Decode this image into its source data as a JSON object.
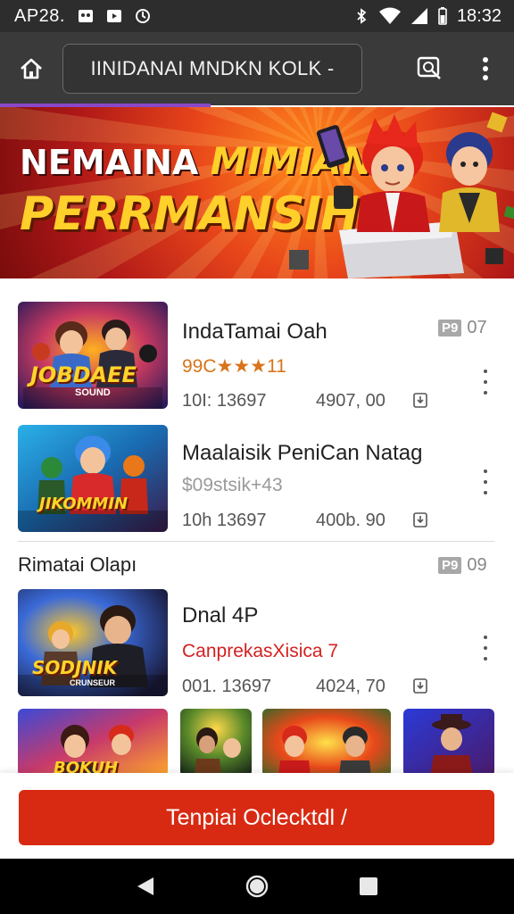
{
  "status_bar": {
    "left_text": "AP28.",
    "clock": "18:32"
  },
  "browser": {
    "url": "IINIDANAI MNDKN KOLK -"
  },
  "banner": {
    "line1_white": "NEMAINA",
    "line1_gold": "MIMIAN",
    "line2": "PERRMANSIH",
    "colors": {
      "bg": "#c21a14",
      "gold": "#ffcf2a"
    }
  },
  "games": [
    {
      "title": "IndaTamai Oah",
      "rating": "99C★★★11",
      "rating_color": "#d8741a",
      "meta1": "10I: 13697",
      "meta2": "4907,  00",
      "badge": "P9",
      "badge_num": "07",
      "thumb_text": "JOBDAEE",
      "thumb_sub": "SOUND"
    },
    {
      "title": "Maalaisik PeniCan Natag",
      "rating": "$09stsik+43",
      "rating_color": "#9a9a9a",
      "meta1": "10h 13697",
      "meta2": "400b. 90",
      "thumb_text": "JIKOMMIN"
    },
    {
      "title": "Dnal 4P",
      "rating": "CanprekasXisica     7",
      "rating_color": "#d42020",
      "meta1": "001. 13697",
      "meta2": "4024, 70",
      "thumb_text": "SODJNIK",
      "thumb_sub": "CRUNSEUR"
    }
  ],
  "section": {
    "title": "Rimatai Olapı",
    "badge": "P9",
    "badge_num": "09"
  },
  "tiles": [
    {
      "text": "BOKUH"
    },
    {
      "text": ""
    },
    {
      "text": ""
    },
    {
      "text": ""
    }
  ],
  "cta": {
    "label": "Tenpiai Oclecktdl /"
  }
}
